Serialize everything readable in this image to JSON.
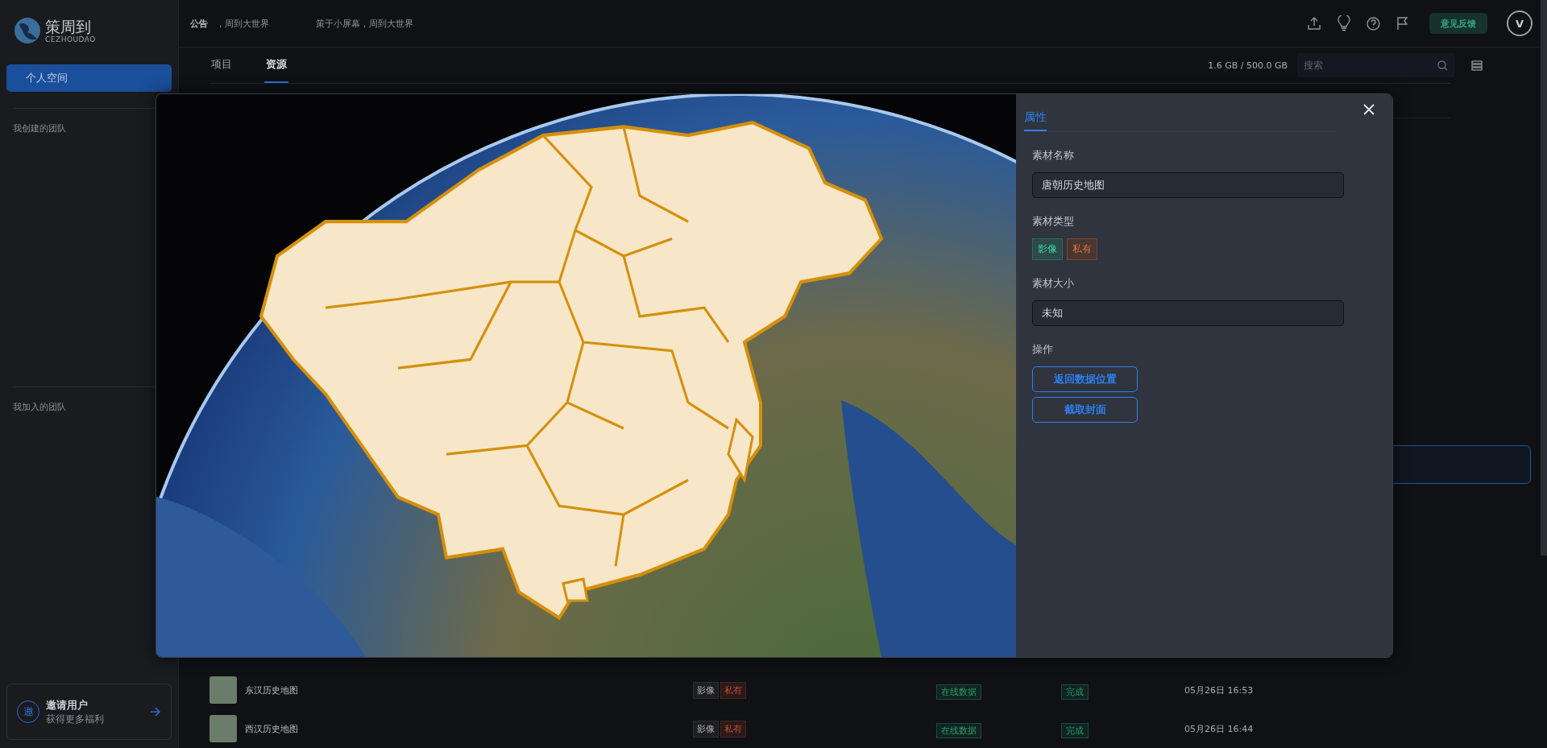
{
  "sidebar": {
    "logo": {
      "name": "策周到",
      "subtitle": "CEZHOUDAO"
    },
    "personal_space": {
      "label": "个人空间",
      "selected": true
    },
    "sections": [
      {
        "title": "我创建的团队"
      },
      {
        "title": "我加入的团队"
      }
    ],
    "invite": {
      "badge": "邀",
      "title": "邀请用户",
      "subtitle": "获得更多福利"
    }
  },
  "header": {
    "announcement_label": "公告",
    "announcements": [
      "，周到大世界",
      "策于小屏幕，周到大世界"
    ],
    "feedback_button": "意见反馈",
    "avatar": "V"
  },
  "tabs": [
    {
      "label": "项目",
      "selected": false
    },
    {
      "label": "资源",
      "selected": true
    }
  ],
  "storage": "1.6 GB / 500.0 GB",
  "search": {
    "placeholder": "搜索"
  },
  "rows": [
    {
      "name": "东汉历史地图",
      "tags": [
        {
          "label": "影像",
          "kind": "type"
        },
        {
          "label": "私有",
          "kind": "private"
        }
      ],
      "source": "在线数据",
      "status": "完成",
      "time": "05月26日 16:53"
    },
    {
      "name": "西汉历史地图",
      "tags": [
        {
          "label": "影像",
          "kind": "type"
        },
        {
          "label": "私有",
          "kind": "private"
        }
      ],
      "source": "在线数据",
      "status": "完成",
      "time": "05月26日 16:44"
    }
  ],
  "modal": {
    "tabs": [
      {
        "label": "属性",
        "selected": true
      }
    ],
    "fields": [
      {
        "kind": "input",
        "label": "素材名称",
        "value": "唐朝历史地图"
      },
      {
        "kind": "tags",
        "label": "素材类型",
        "tags": [
          {
            "label": "影像",
            "kind": "type"
          },
          {
            "label": "私有",
            "kind": "private"
          }
        ]
      },
      {
        "kind": "input",
        "label": "素材大小",
        "value": "未知"
      },
      {
        "kind": "actions",
        "label": "操作",
        "buttons": [
          "返回数据位置",
          "截取封面"
        ]
      }
    ]
  }
}
